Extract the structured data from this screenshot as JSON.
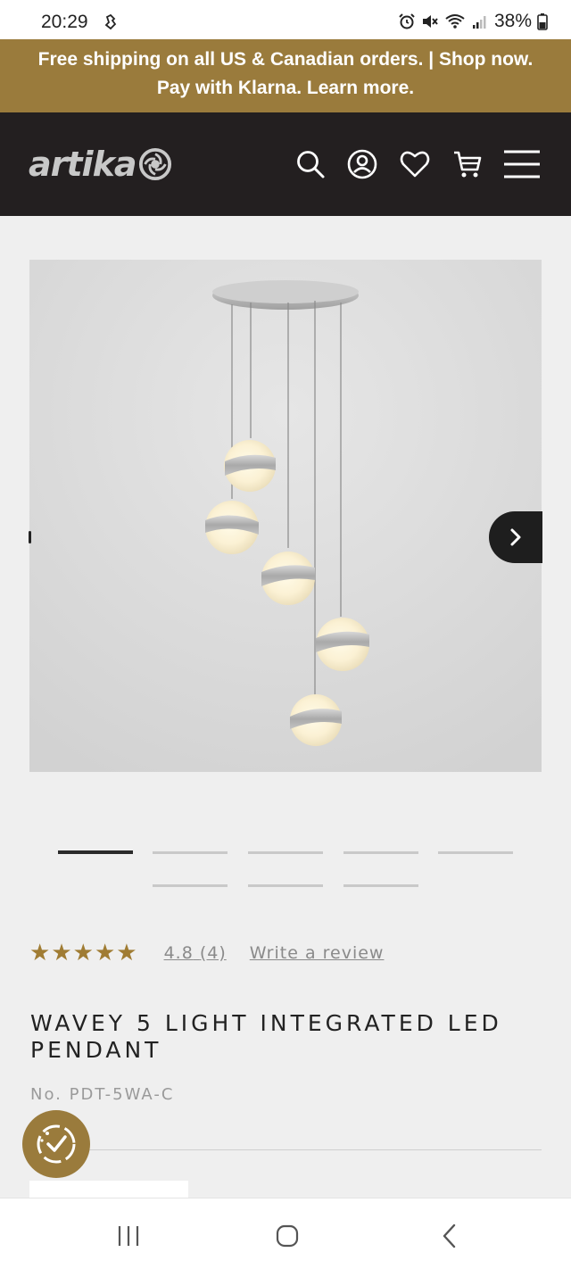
{
  "status_bar": {
    "time": "20:29",
    "battery": "38%"
  },
  "promo": {
    "line1": "Free shipping on all US & Canadian orders. | Shop now.",
    "line2": "Pay with Klarna. Learn more."
  },
  "header": {
    "logo_text": "artika",
    "nav_icons": [
      "search-icon",
      "account-icon",
      "wishlist-heart-icon",
      "cart-icon",
      "menu-icon"
    ]
  },
  "gallery": {
    "slide_count": 8,
    "active_slide": 1
  },
  "product": {
    "rating_value": "4.8",
    "rating_count": "(4)",
    "stars": 5,
    "write_review": "Write a review",
    "title": "WAVEY 5 LIGHT INTEGRATED LED PENDANT",
    "sku": "No. PDT-5WA-C"
  },
  "colors": {
    "brand_gold": "#9a7b3c",
    "header_dark": "#231f20",
    "star_gold": "#a07c33"
  }
}
